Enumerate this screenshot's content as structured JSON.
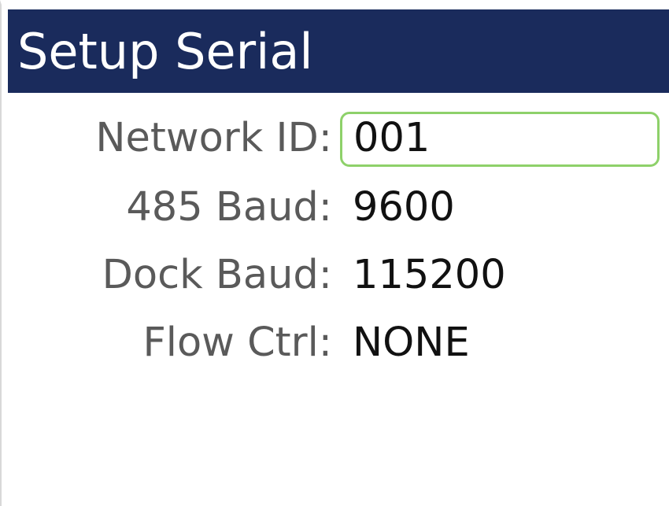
{
  "title": "Setup Serial",
  "fields": [
    {
      "label": "Network ID:",
      "value": "001"
    },
    {
      "label": "485 Baud:",
      "value": "9600"
    },
    {
      "label": "Dock Baud:",
      "value": "115200"
    },
    {
      "label": "Flow Ctrl:",
      "value": "NONE"
    }
  ],
  "colors": {
    "title_bg": "#1a2b5c",
    "focus_border": "#8ed16a"
  }
}
